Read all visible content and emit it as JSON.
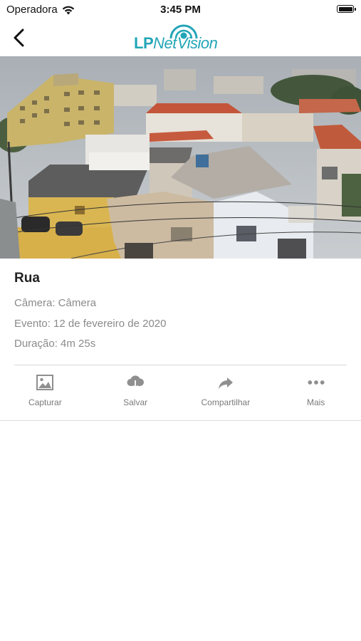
{
  "status_bar": {
    "carrier": "Operadora",
    "time": "3:45 PM",
    "icons": [
      "wifi-icon",
      "battery-icon"
    ]
  },
  "nav": {
    "back_icon": "chevron-left-icon",
    "logo": {
      "part1": "LP",
      "part2": "Net",
      "part3": "Vision",
      "color": "#22a6b7"
    }
  },
  "event": {
    "title": "Rua",
    "camera": "Câmera: Câmera",
    "date": "Evento: 12 de fevereiro de 2020",
    "duration": "Duração: 4m 25s"
  },
  "actions": [
    {
      "label": "Capturar",
      "icon": "image-icon"
    },
    {
      "label": "Salvar",
      "icon": "cloud-download-icon"
    },
    {
      "label": "Compartilhar",
      "icon": "share-arrow-icon"
    },
    {
      "label": "Mais",
      "icon": "more-dots-icon"
    }
  ],
  "colors": {
    "accent": "#22a6b7",
    "icon_gray": "#8f8f8f",
    "meta_text": "#8a8a8a"
  }
}
